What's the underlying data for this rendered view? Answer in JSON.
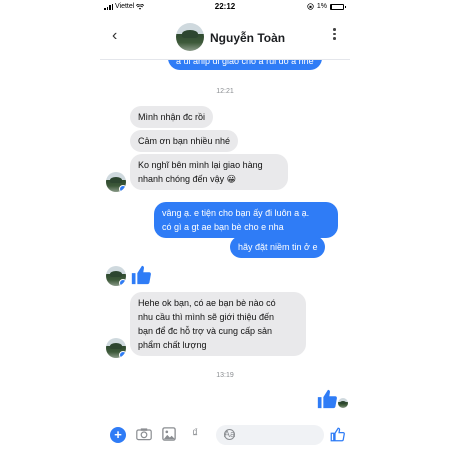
{
  "status_bar": {
    "carrier": "Viettel",
    "time": "22:12",
    "battery_text": "1%",
    "battery_level": 0.01
  },
  "header": {
    "contact_name": "Nguyễn Toàn"
  },
  "messages": {
    "top_cut": "a ui ahip đi giao cho a rùi đó a nhé",
    "ts1": "12:21",
    "in1": "Mình nhận đc rồi",
    "in2": "Cảm ơn bạn nhiều nhé",
    "in3_line1": "Ko nghĩ bên mình lại giao hàng",
    "in3_line2": "nhanh chóng đến vậy 😀",
    "out1_line1": "vâng ạ. e tiện cho bạn ấy đi luôn a ạ.",
    "out1_line2": "có gì a gt ae bạn bè cho e nha",
    "out2": "hãy đặt niềm tin ở e",
    "in4_line1": "Hehe ok bạn, có ae bạn bè nào có",
    "in4_line2": "nhu cầu thì mình sẽ giới thiệu đến",
    "in4_line3": "bạn để đc hỗ trợ và cung cấp sản",
    "in4_line4": "phẩm chất lượng",
    "ts2": "13:19"
  },
  "composer": {
    "placeholder": "Aa"
  },
  "colors": {
    "accent": "#2f7cf6",
    "incoming": "#e9e9eb"
  }
}
